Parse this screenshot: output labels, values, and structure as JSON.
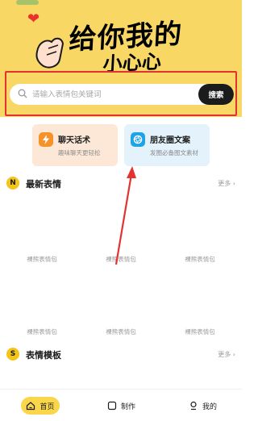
{
  "hero": {
    "headline_line1": "给你我的",
    "headline_line2": "小心心",
    "heart": "heart-icon"
  },
  "search": {
    "placeholder": "请输入表情包关键词",
    "button_label": "搜索"
  },
  "features": [
    {
      "title": "聊天话术",
      "subtitle": "趣味聊天更轻松",
      "icon": "lightning-icon"
    },
    {
      "title": "朋友圈文案",
      "subtitle": "发圈必备图文素材",
      "icon": "aperture-icon"
    }
  ],
  "sections": {
    "latest": {
      "badge": "N",
      "title": "最新表情",
      "more": "更多"
    },
    "templates": {
      "badge": "S",
      "title": "表情模板",
      "more": "更多"
    }
  },
  "stickers": [
    "裸熊表情包",
    "裸熊表情包",
    "裸熊表情包",
    "裸熊表情包",
    "裸熊表情包",
    "裸熊表情包"
  ],
  "nav": [
    {
      "label": "首页",
      "icon": "home-icon",
      "active": true
    },
    {
      "label": "制作",
      "icon": "edit-square-icon",
      "active": false
    },
    {
      "label": "我的",
      "icon": "user-icon",
      "active": false
    }
  ],
  "colors": {
    "banner": "#f8d764",
    "accent_yellow": "#f9d64a",
    "annotation_red": "#e3322f"
  }
}
